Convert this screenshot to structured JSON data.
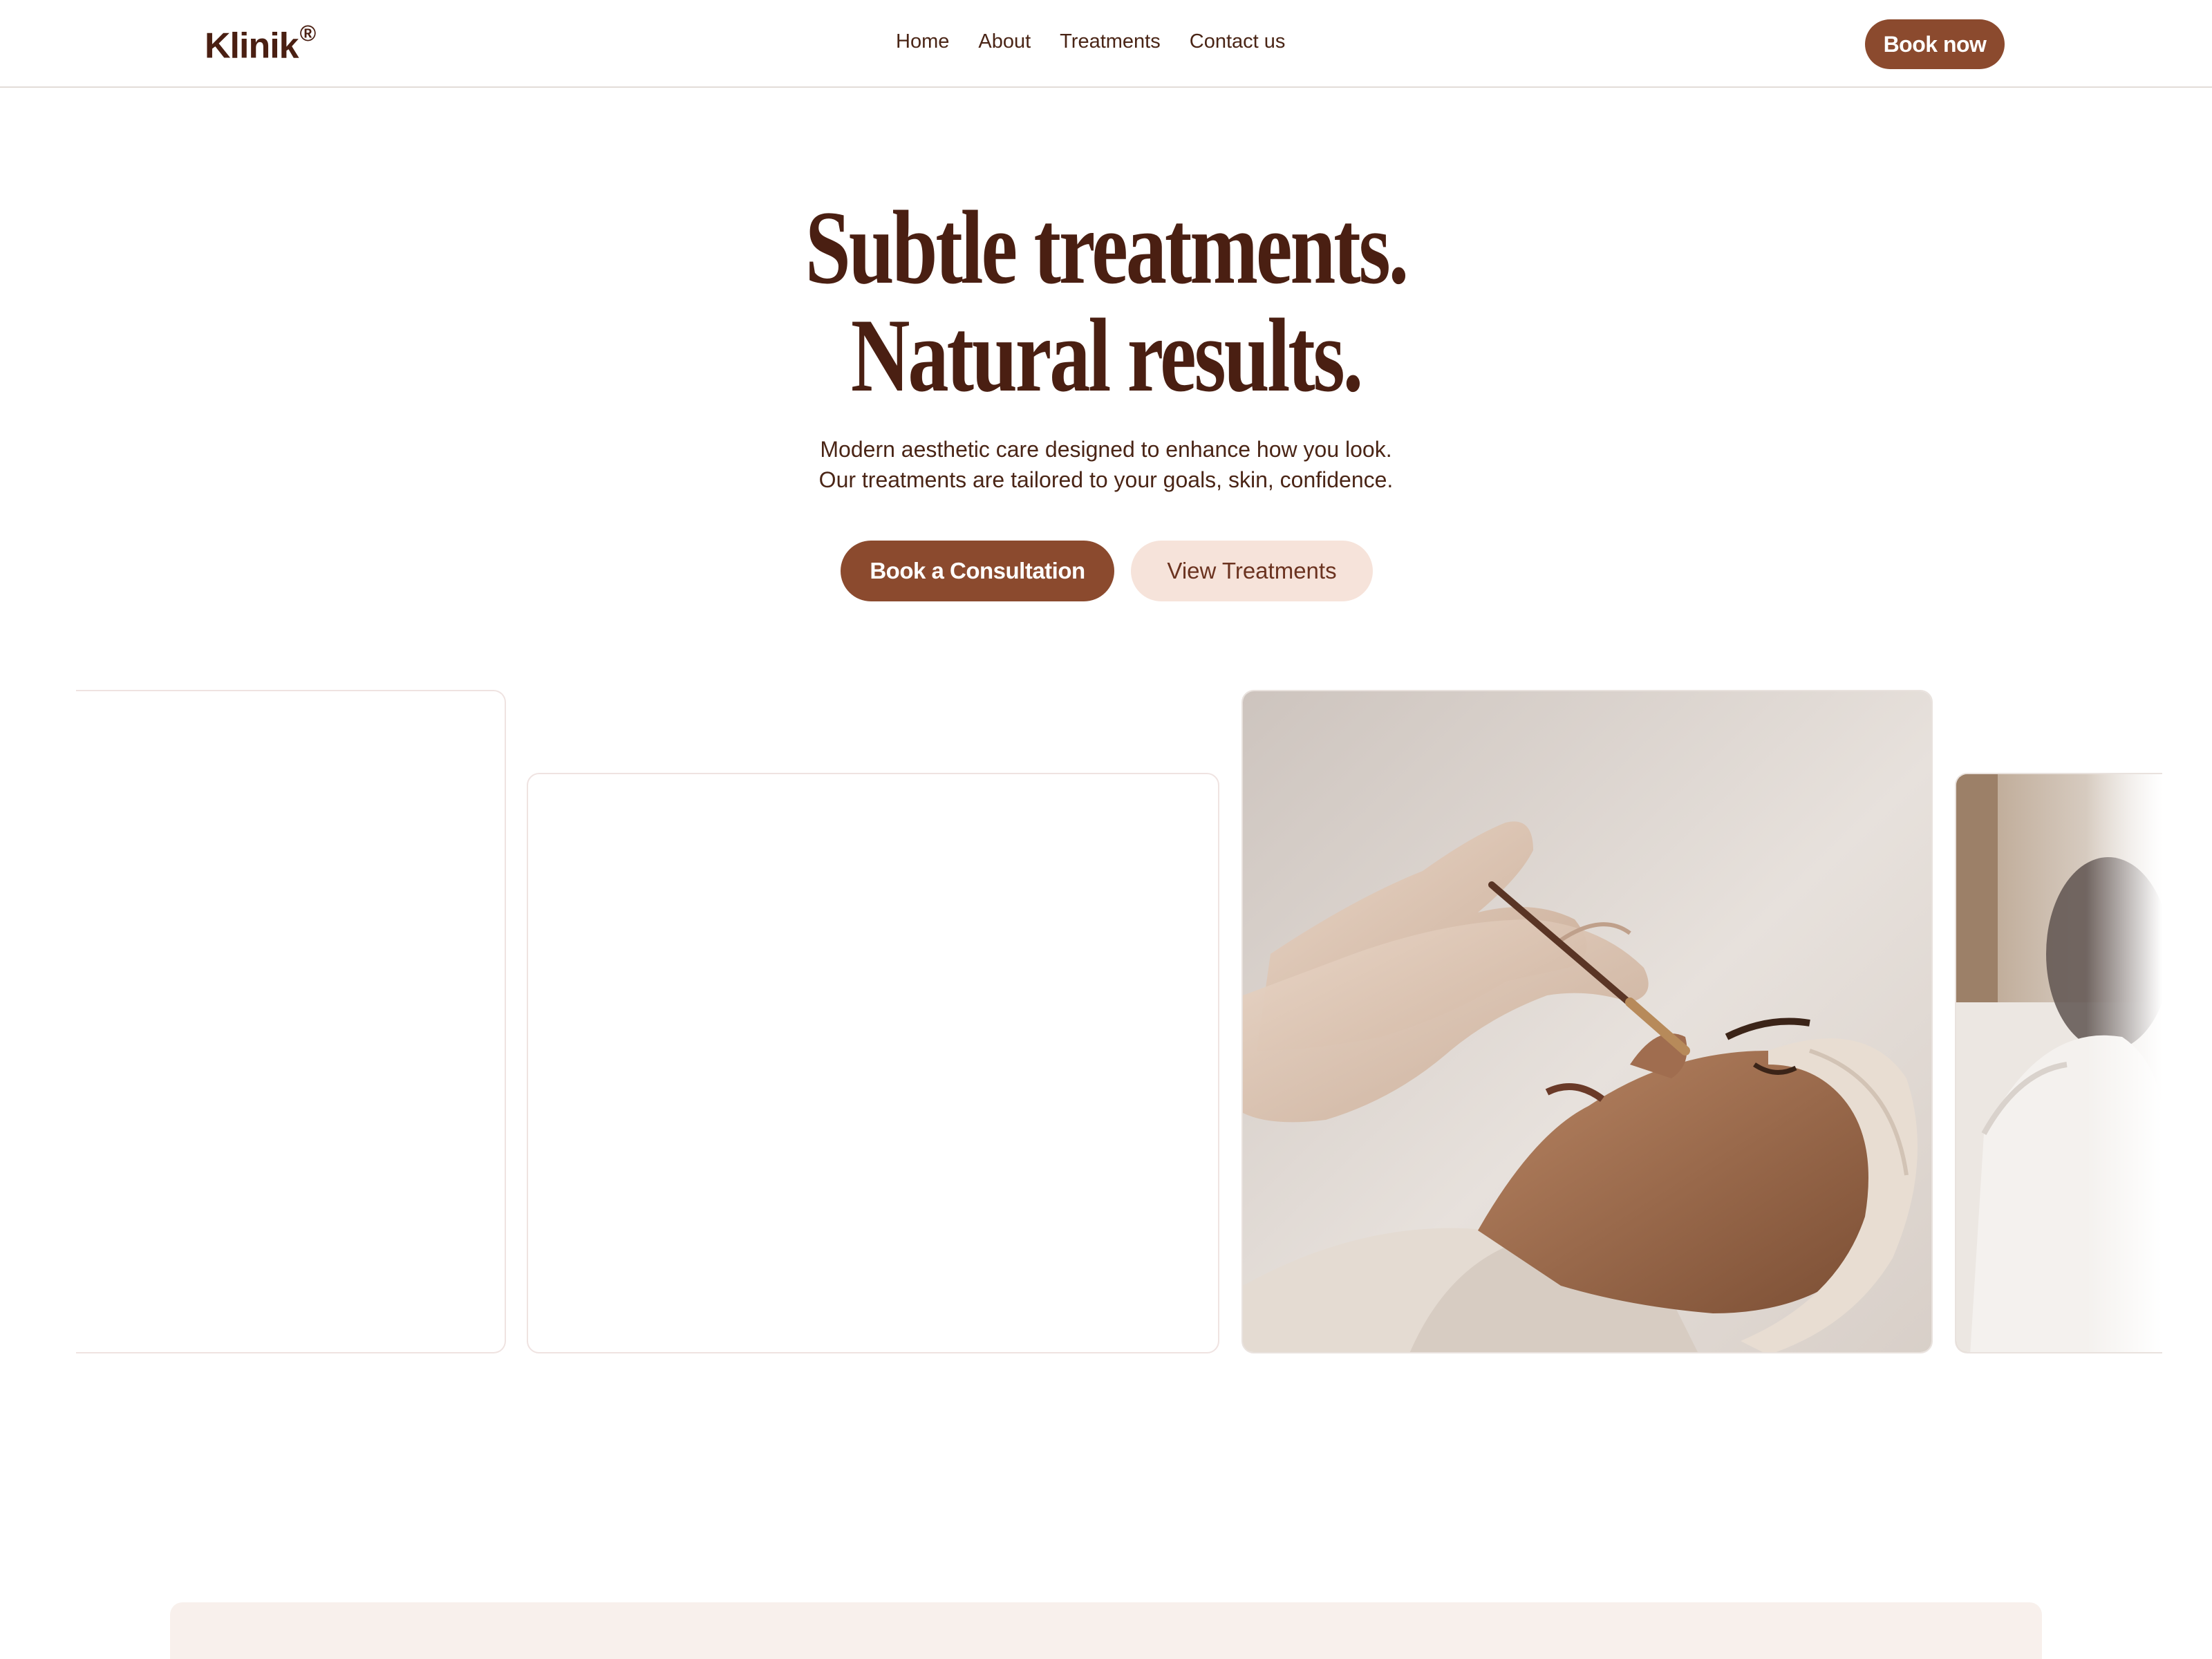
{
  "nav": {
    "brand": "Klinik",
    "brand_mark": "®",
    "links": [
      "Home",
      "About",
      "Treatments",
      "Contact us"
    ],
    "cta": "Book now"
  },
  "hero": {
    "title_line1": "Subtle treatments.",
    "title_line2": "Natural results.",
    "subtitle_line1": "Modern aesthetic care designed to enhance how you look.",
    "subtitle_line2": "Our treatments are tailored to your goals, skin, confidence.",
    "primary_cta": "Book a Consultation",
    "secondary_cta": "View Treatments"
  },
  "colors": {
    "brand_brown": "#8b4a2e",
    "heading_brown": "#4a1f12",
    "soft_peach": "#f6e3da",
    "panel_cream": "#f8f0ec"
  }
}
